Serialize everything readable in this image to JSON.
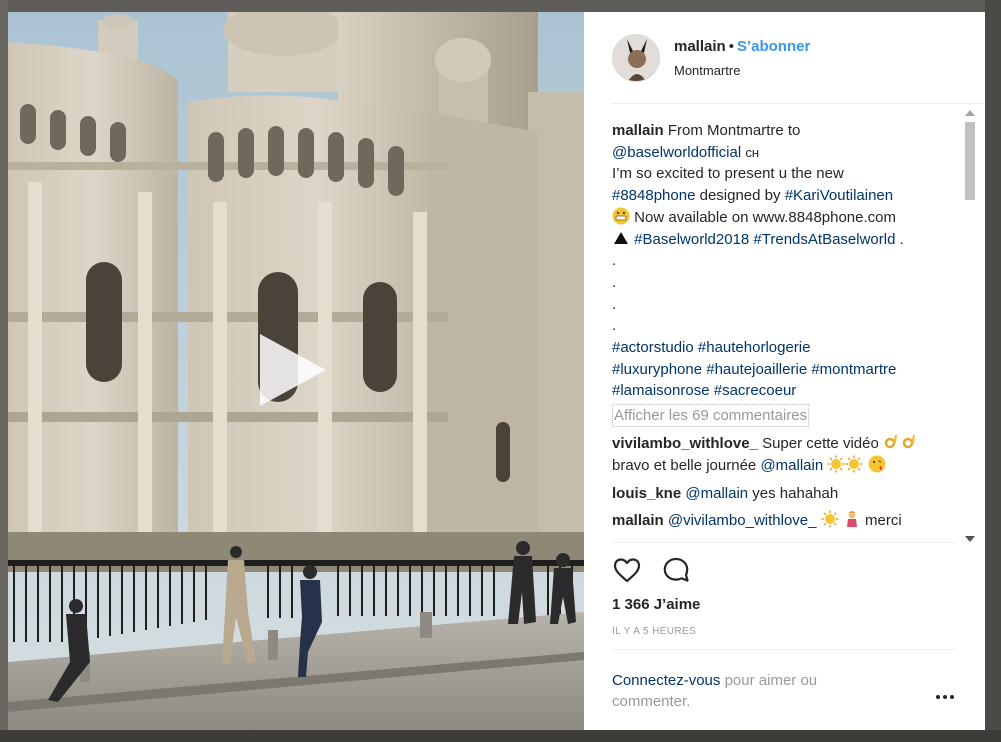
{
  "colors": {
    "accent_blue": "#3897f0",
    "link_dark": "#003569",
    "text": "#262626",
    "muted": "#999999"
  },
  "media": {
    "type": "video",
    "play_icon": "play-icon"
  },
  "header": {
    "username": "mallain",
    "separator": "•",
    "follow_label": "S’abonner",
    "location": "Montmartre"
  },
  "caption": {
    "author": "mallain",
    "lines": [
      "From Montmartre to",
      "@baselworldofficial",
      "ᴄʜ",
      "I’m so excited to present u the new",
      "#8848phone",
      "designed by",
      "#KariVoutilainen",
      "Now available on www.8848phone.com",
      "#Baselworld2018",
      "#TrendsAtBaselworld",
      ".",
      ".",
      ".",
      ".",
      ".",
      "#actorstudio",
      "#hautehorlogerie",
      "#luxuryphone",
      "#hautejoaillerie",
      "#montmartre",
      "#lamaisonrose",
      "#sacrecoeur"
    ]
  },
  "load_more_label": "Afficher les 69 commentaires",
  "comments": [
    {
      "author": "vivilambo_withlove_",
      "line1": "Super cette vidéo",
      "line2a": "bravo et belle journée",
      "mention": "@mallain"
    },
    {
      "author": "louis_kne",
      "mention": "@mallain",
      "text": "yes hahahah"
    },
    {
      "author": "mallain",
      "mention": "@vivilambo_withlove_",
      "text": "merci"
    }
  ],
  "actions": {
    "like_icon": "heart-outline-icon",
    "comment_icon": "speech-bubble-icon",
    "likes_text": "1 366 J’aime",
    "time_text": "IL Y A 5 HEURES"
  },
  "login": {
    "link_text": "Connectez-vous",
    "rest_text": "pour aimer ou commenter.",
    "more_icon": "more-options-icon"
  }
}
